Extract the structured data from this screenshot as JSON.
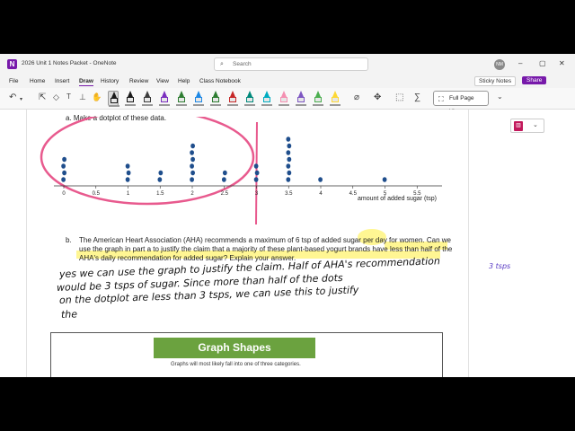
{
  "window": {
    "app_logo": "N",
    "doc_title": "2026 Unit 1 Notes Packet - OneNote",
    "search_placeholder": "Search",
    "avatar_initials": "NM",
    "controls": [
      "–",
      "▢",
      "✕"
    ]
  },
  "menu": {
    "items": [
      "File",
      "Home",
      "Insert",
      "Draw",
      "History",
      "Review",
      "View",
      "Help",
      "Class Notebook"
    ],
    "active": "Draw",
    "sticky_notes": "Sticky Notes",
    "share": "Share"
  },
  "ribbon": {
    "undo_icon": "undo-icon",
    "pen_colors": [
      "#1a1a1a",
      "#1a1a1a",
      "#3c3c3c",
      "#7b2fbf",
      "#2e7d32",
      "#1e88e5",
      "#2e7d32",
      "#c62828",
      "#00897b",
      "#00acc1",
      "#f48fb1",
      "#7e57c2",
      "#4caf50",
      "#fdd835"
    ],
    "full_page_view": "Full Page View"
  },
  "content": {
    "question_a": "a.   Make a dotplot of these data.",
    "question_b_label": "b.",
    "question_b_text": "The American Heart Association (AHA) recommends a maximum of 6 tsp of added sugar per day for women. Can we use the graph in part a to justify the claim that a majority of these plant-based yogurt brands have less than half of the AHA's daily recommendation for added sugar? Explain your answer.",
    "handwriting": [
      "yes we can use the graph to justify the claim. Half of AHA's recommendation",
      "would be 3 tsps of sugar. Since more than half of the dots",
      "on the dotplot are less than 3 tsps, we can use this to justify",
      "the"
    ],
    "margin_note": "3 tsps",
    "graph_shapes_title": "Graph Shapes",
    "graph_shapes_sub": "Graphs will most likely fall into one of three categories."
  },
  "chart_data": {
    "type": "scatter",
    "xlabel": "amount of added sugar (tsp)",
    "tick_labels": [
      "0",
      "0.5",
      "1",
      "1.5",
      "2",
      "2.5",
      "3",
      "3.5",
      "4",
      "4.5",
      "5",
      "5.5"
    ],
    "xlim": [
      0,
      5.5
    ],
    "dots": [
      {
        "x": 0,
        "count": 4
      },
      {
        "x": 1,
        "count": 3
      },
      {
        "x": 1.5,
        "count": 2
      },
      {
        "x": 2,
        "count": 6
      },
      {
        "x": 2.5,
        "count": 2
      },
      {
        "x": 3,
        "count": 3
      },
      {
        "x": 3.5,
        "count": 7
      },
      {
        "x": 4,
        "count": 1
      },
      {
        "x": 5,
        "count": 1
      }
    ]
  }
}
